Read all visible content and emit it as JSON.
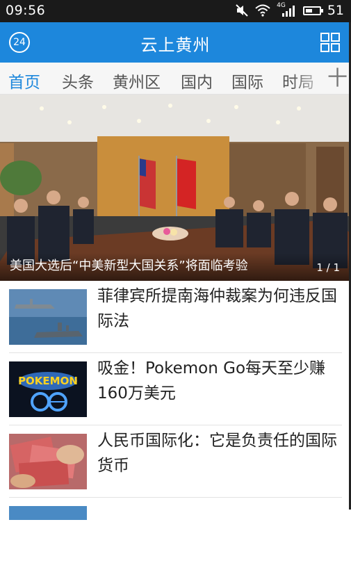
{
  "status_bar": {
    "time": "09:56",
    "network": "4G",
    "battery": "51",
    "battery_level": 0.51
  },
  "header": {
    "title": "云上黄州",
    "badge": "24"
  },
  "tabs": [
    "首页",
    "头条",
    "黄州区",
    "国内",
    "国际",
    "时局"
  ],
  "tabs_add_label": "十",
  "hero": {
    "caption": "美国大选后“中美新型大国关系”将面临考验",
    "pager": "1 / 1"
  },
  "news": [
    {
      "headline": "菲律宾所提南海仲裁案为何违反国际法"
    },
    {
      "headline": "吸金！Pokemon Go每天至少赚160万美元"
    },
    {
      "headline": "人民币国际化：它是负责任的国际货币"
    }
  ],
  "colors": {
    "accent": "#1d87dc",
    "status_bar": "#1a1a1a"
  }
}
